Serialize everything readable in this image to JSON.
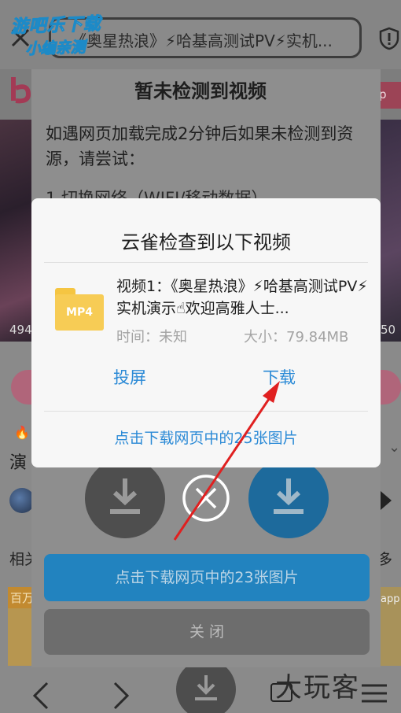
{
  "browser": {
    "url_text": "《奥星热浪》⚡哈基高测试PV⚡实机...",
    "bg_pill_text": "p",
    "bg_stat_left": "494",
    "bg_stat_right": "50",
    "bg_text_yan": "演",
    "bg_text_xiang": "相关",
    "bg_text_duo": "多",
    "bg_card_left": "百万",
    "bg_card_right": "app"
  },
  "back_dialog": {
    "title": "暂未检测到视频",
    "body": "如遇网页加载完成2分钟后如果未检测到资源，请尝试：",
    "hidden_line": "1.切换网络（WIFI/移动数据）",
    "download_images_button": "点击下载网页中的23张图片",
    "close_button": "关 闭"
  },
  "front_dialog": {
    "title": "云雀检查到以下视频",
    "file_badge": "MP4",
    "file_name": "视频1：《奥星热浪》⚡哈基高测试PV⚡实机演示☝欢迎高雅人士...",
    "time_text": "时间：未知",
    "size_text": "大小：79.84MB",
    "cast_button": "投屏",
    "download_button": "下载",
    "download_images_link": "点击下载网页中的25张图片"
  },
  "watermarks": {
    "top_left_line1": "游吧乐下载",
    "top_left_line2": "小编亲测",
    "bottom_right": "大玩客"
  },
  "colors": {
    "accent_blue": "#2b8ad6",
    "folder_yellow": "#f7cc55",
    "annotation_red": "#e02020"
  }
}
